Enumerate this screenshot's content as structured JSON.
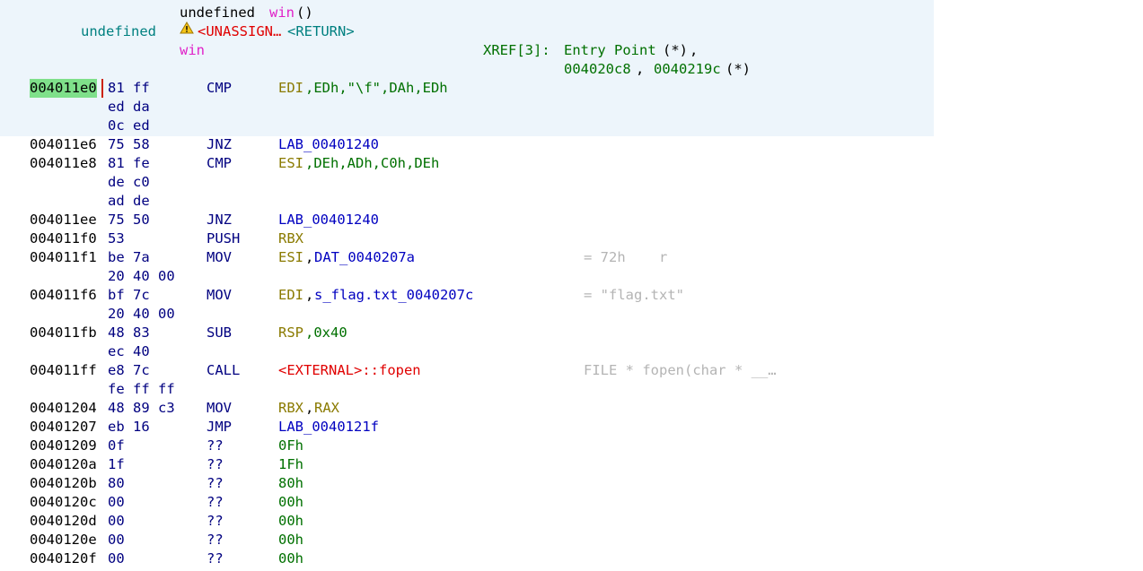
{
  "header": {
    "ret_type": "undefined",
    "fn_name": "win",
    "parens": "()",
    "sig_ret_type": "undefined",
    "ret_storage": "<UNASSIGN…",
    "ret_label": "<RETURN>",
    "label": "win",
    "xref_label": "XREF[3]:",
    "xref_entry": "Entry Point",
    "xref_mark": "(*)",
    "xref_sep": ",",
    "xref_addr1": "004020c8",
    "xref_sep2": ",",
    "xref_addr2": "0040219c",
    "xref_mark2": "(*)",
    "warning_icon": "warning-icon"
  },
  "rows": [
    {
      "addr": "004011e0",
      "bytes": "81 ff",
      "mnemonic": "CMP",
      "op_a": "EDI",
      "op_b": ",EDh,\"\\f\",DAh,EDh",
      "comment": "",
      "selected": true
    },
    {
      "addr": "",
      "bytes": "ed da",
      "mnemonic": "",
      "op_a": "",
      "op_b": "",
      "comment": ""
    },
    {
      "addr": "",
      "bytes": "0c ed",
      "mnemonic": "",
      "op_a": "",
      "op_b": "",
      "comment": ""
    },
    {
      "addr": "004011e6",
      "bytes": "75 58",
      "mnemonic": "JNZ",
      "op_a": "LAB_00401240",
      "op_b": "",
      "comment": ""
    },
    {
      "addr": "004011e8",
      "bytes": "81 fe",
      "mnemonic": "CMP",
      "op_a": "ESI",
      "op_b": ",DEh,ADh,C0h,DEh",
      "comment": ""
    },
    {
      "addr": "",
      "bytes": "de c0",
      "mnemonic": "",
      "op_a": "",
      "op_b": "",
      "comment": ""
    },
    {
      "addr": "",
      "bytes": "ad de",
      "mnemonic": "",
      "op_a": "",
      "op_b": "",
      "comment": ""
    },
    {
      "addr": "004011ee",
      "bytes": "75 50",
      "mnemonic": "JNZ",
      "op_a": "LAB_00401240",
      "op_b": "",
      "comment": ""
    },
    {
      "addr": "004011f0",
      "bytes": "53",
      "mnemonic": "PUSH",
      "op_a": "RBX",
      "op_b": "",
      "comment": ""
    },
    {
      "addr": "004011f1",
      "bytes": "be 7a",
      "mnemonic": "MOV",
      "op_a": "ESI",
      "op_b": ",",
      "op_c": "DAT_0040207a",
      "comment": "= 72h    r"
    },
    {
      "addr": "",
      "bytes": "20 40 00",
      "mnemonic": "",
      "op_a": "",
      "op_b": "",
      "comment": ""
    },
    {
      "addr": "004011f6",
      "bytes": "bf 7c",
      "mnemonic": "MOV",
      "op_a": "EDI",
      "op_b": ",",
      "op_c": "s_flag.txt_0040207c",
      "comment": "= \"flag.txt\""
    },
    {
      "addr": "",
      "bytes": "20 40 00",
      "mnemonic": "",
      "op_a": "",
      "op_b": "",
      "comment": ""
    },
    {
      "addr": "004011fb",
      "bytes": "48 83",
      "mnemonic": "SUB",
      "op_a": "RSP",
      "op_b": ",0x40",
      "comment": ""
    },
    {
      "addr": "",
      "bytes": "ec 40",
      "mnemonic": "",
      "op_a": "",
      "op_b": "",
      "comment": ""
    },
    {
      "addr": "004011ff",
      "bytes": "e8 7c",
      "mnemonic": "CALL",
      "op_a": "<EXTERNAL>::fopen",
      "op_b": "",
      "comment": "FILE * fopen(char * __…"
    },
    {
      "addr": "",
      "bytes": "fe ff ff",
      "mnemonic": "",
      "op_a": "",
      "op_b": "",
      "comment": ""
    },
    {
      "addr": "00401204",
      "bytes": "48 89 c3",
      "mnemonic": "MOV",
      "op_a": "RBX",
      "op_b": ",",
      "op_c": "RAX",
      "comment": ""
    },
    {
      "addr": "00401207",
      "bytes": "eb 16",
      "mnemonic": "JMP",
      "op_a": "LAB_0040121f",
      "op_b": "",
      "comment": ""
    },
    {
      "addr": "00401209",
      "bytes": "0f",
      "mnemonic": "??",
      "op_a": "0Fh",
      "op_b": "",
      "comment": ""
    },
    {
      "addr": "0040120a",
      "bytes": "1f",
      "mnemonic": "??",
      "op_a": "1Fh",
      "op_b": "",
      "comment": ""
    },
    {
      "addr": "0040120b",
      "bytes": "80",
      "mnemonic": "??",
      "op_a": "80h",
      "op_b": "",
      "comment": ""
    },
    {
      "addr": "0040120c",
      "bytes": "00",
      "mnemonic": "??",
      "op_a": "00h",
      "op_b": "",
      "comment": ""
    },
    {
      "addr": "0040120d",
      "bytes": "00",
      "mnemonic": "??",
      "op_a": "00h",
      "op_b": "",
      "comment": ""
    },
    {
      "addr": "0040120e",
      "bytes": "00",
      "mnemonic": "??",
      "op_a": "00h",
      "op_b": "",
      "comment": ""
    },
    {
      "addr": "0040120f",
      "bytes": "00",
      "mnemonic": "??",
      "op_a": "00h",
      "op_b": "",
      "comment": ""
    }
  ],
  "colors": {
    "header_bg": "#edf5fb",
    "selection": "#7fe08a",
    "register": "#8a7a00",
    "label": "#0000c0",
    "scalar": "#007000",
    "external": "#e00000",
    "comment": "#b4b4b4"
  }
}
